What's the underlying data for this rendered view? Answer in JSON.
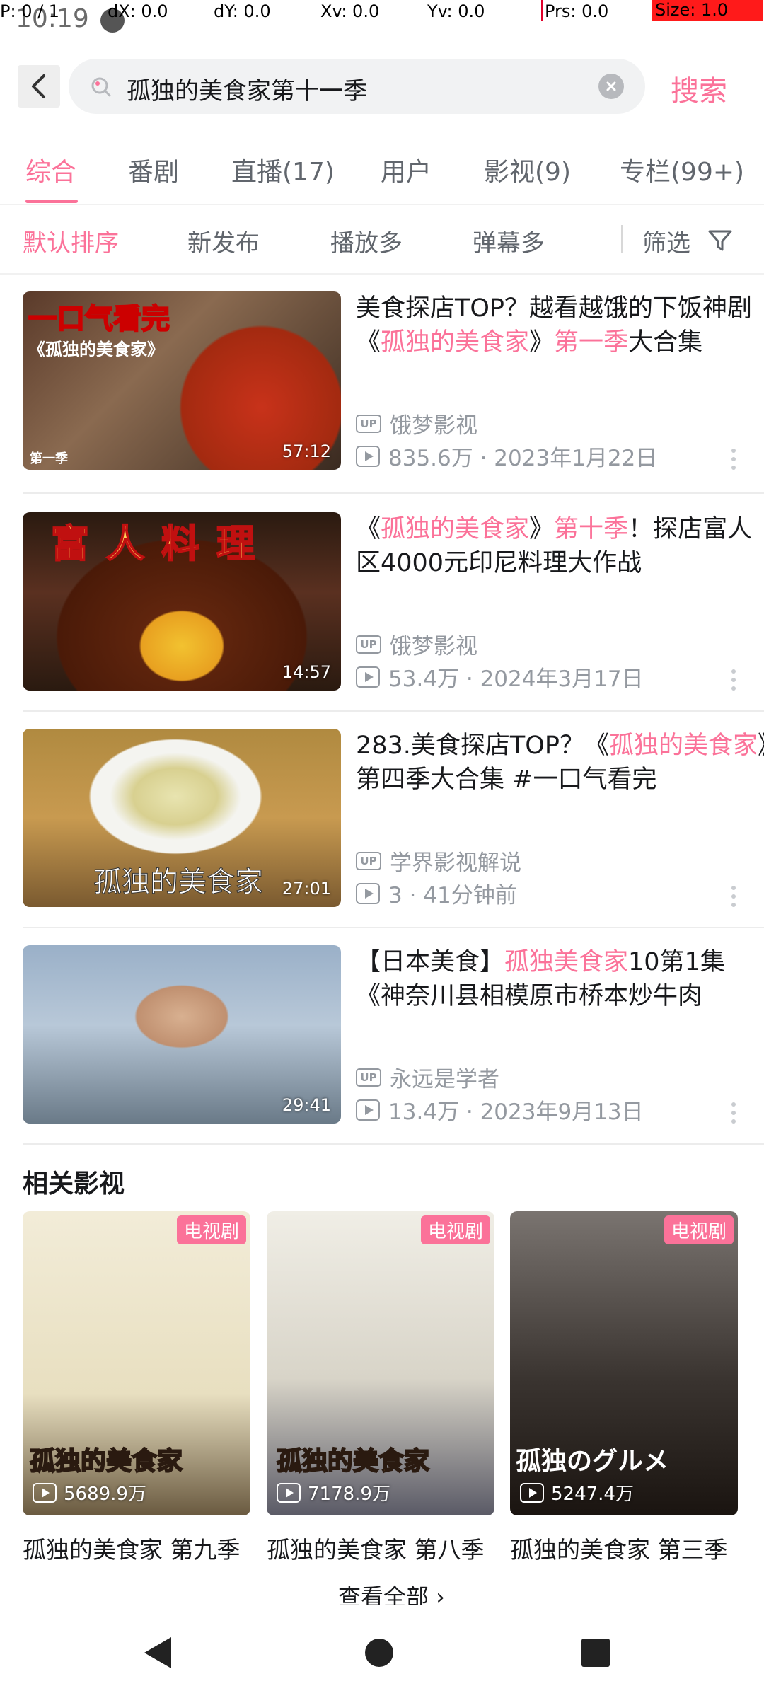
{
  "status": {
    "time": "10:19",
    "debug": {
      "p": "P: 0 / 1",
      "dx": "dX: 0.0",
      "dy": "dY: 0.0",
      "xv": "Xv: 0.0",
      "yv": "Yv: 0.0",
      "prs": "Prs: 0.0",
      "size": "Size: 1.0"
    }
  },
  "search": {
    "query": "孤独的美食家第十一季",
    "button_label": "搜索"
  },
  "tabs": [
    {
      "label": "综合",
      "active": true
    },
    {
      "label": "番剧"
    },
    {
      "label": "直播(17)"
    },
    {
      "label": "用户"
    },
    {
      "label": "影视(9)"
    },
    {
      "label": "专栏(99+)"
    }
  ],
  "sort": [
    {
      "label": "默认排序",
      "active": true
    },
    {
      "label": "新发布"
    },
    {
      "label": "播放多"
    },
    {
      "label": "弹幕多"
    }
  ],
  "filter_label": "筛选",
  "videos": [
    {
      "title_parts": [
        "美食探店TOP？越看越饿的下饭神剧《",
        "孤独的美食家",
        "》",
        "第一季",
        "大合集"
      ],
      "uploader": "饿梦影视",
      "stats": "835.6万 · 2023年1月22日",
      "duration": "57:12",
      "thumb_text": "一口气看完",
      "thumb_sub": "《孤独的美食家》",
      "thumb_corner": "第一季"
    },
    {
      "title_parts": [
        "《",
        "孤独的美食家",
        "》",
        "第十季",
        "！探店富人区4000元印尼料理大作战"
      ],
      "uploader": "饿梦影视",
      "stats": "53.4万 · 2024年3月17日",
      "duration": "14:57",
      "thumb_text": "富人料理"
    },
    {
      "title_parts": [
        "283.美食探店TOP？《",
        "孤独的美食家",
        "》第四季大合集 #一口气看完"
      ],
      "uploader": "学界影视解说",
      "stats": "3 · 41分钟前",
      "duration": "27:01",
      "thumb_text": "孤独的美食家"
    },
    {
      "title_parts": [
        "【日本美食】",
        "孤独美食家",
        "10第1集《神奈川县相模原市桥本炒牛肉"
      ],
      "uploader": "永远是学者",
      "stats": "13.4万 · 2023年9月13日",
      "duration": "29:41"
    }
  ],
  "related": {
    "title": "相关影视",
    "items": [
      {
        "badge": "电视剧",
        "views": "5689.9万",
        "title": "孤独的美食家 第九季",
        "poster_text": "孤独的美食家"
      },
      {
        "badge": "电视剧",
        "views": "7178.9万",
        "title": "孤独的美食家 第八季",
        "poster_text": "孤独的美食家"
      },
      {
        "badge": "电视剧",
        "views": "5247.4万",
        "title": "孤独的美食家 第三季",
        "poster_text": "孤独のグルメ"
      }
    ],
    "view_all": "查看全部 ›"
  },
  "colors": {
    "accent": "#fb7299",
    "text_primary": "#18191c",
    "text_secondary": "#9499a0"
  }
}
